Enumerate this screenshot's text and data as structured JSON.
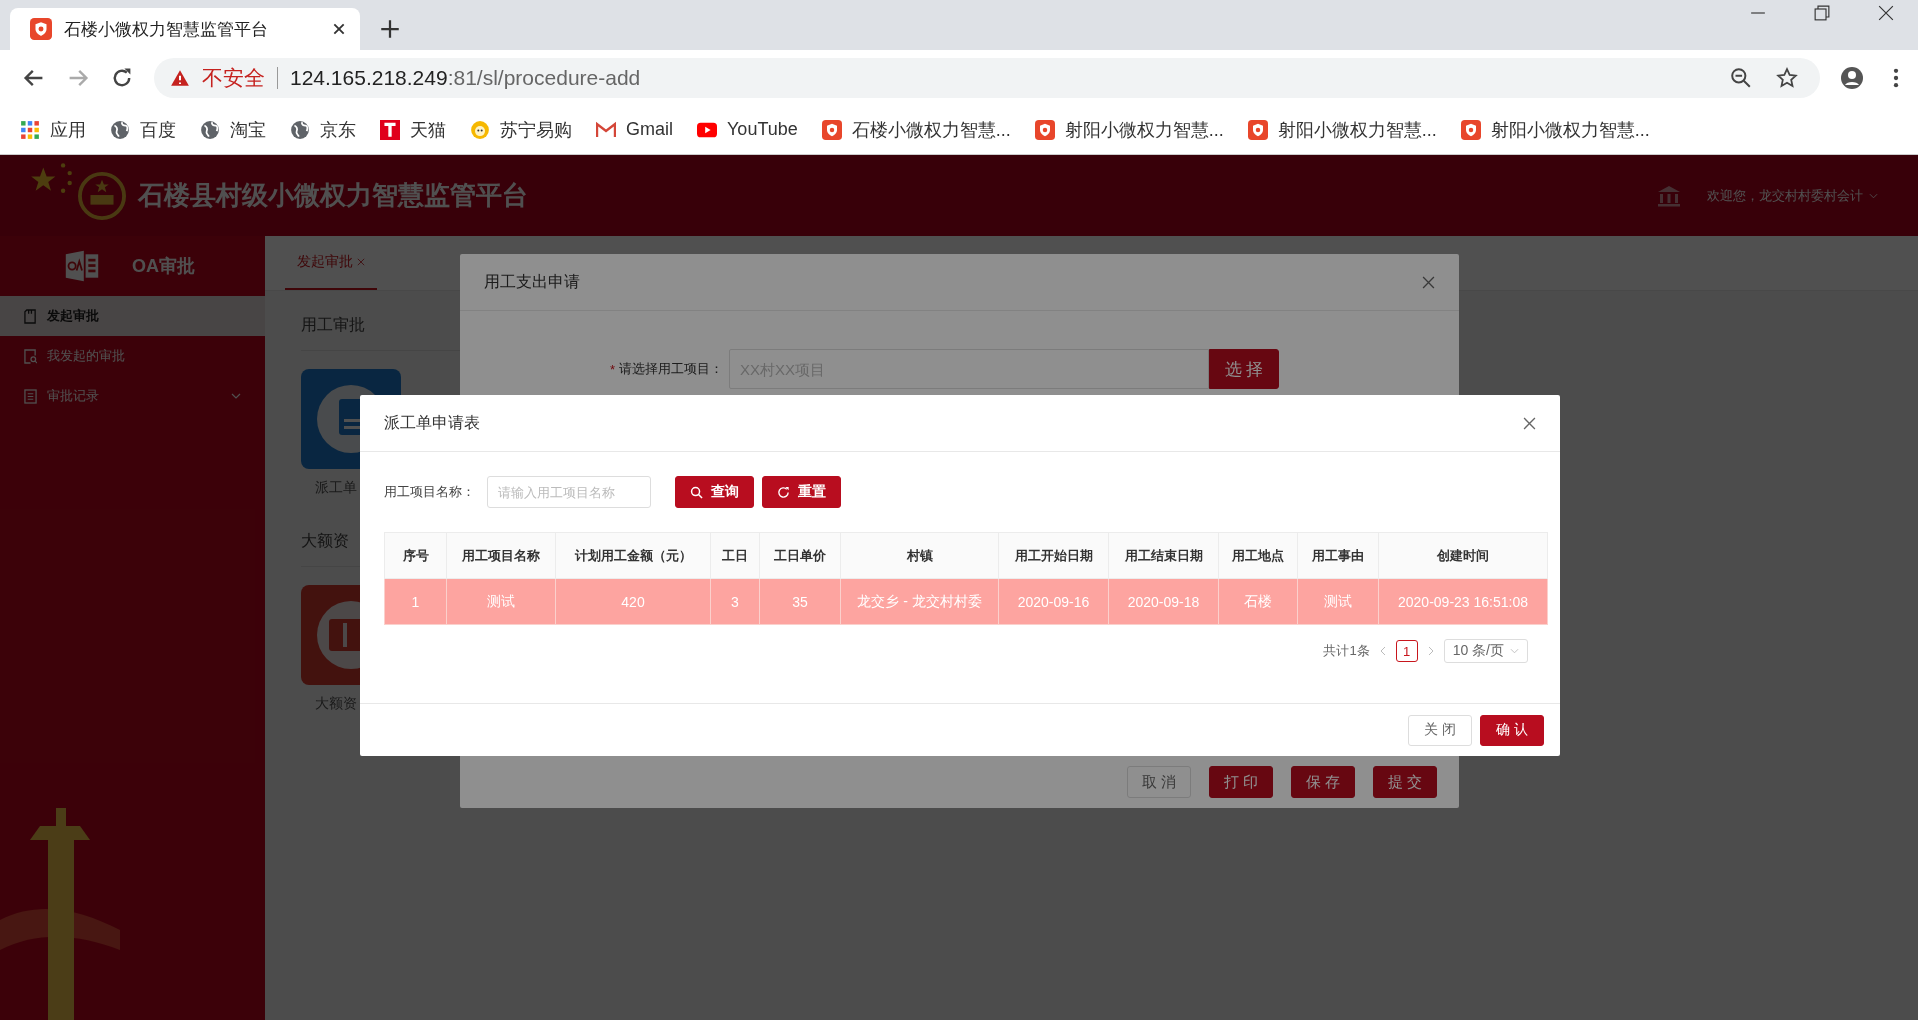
{
  "browser": {
    "tab_title": "石楼小微权力智慧监管平台",
    "security": "不安全",
    "url_host": "124.165.218.249",
    "url_rest": ":81/sl/procedure-add",
    "bookmarks": [
      {
        "label": "应用",
        "kind": "apps"
      },
      {
        "label": "百度",
        "kind": "globe"
      },
      {
        "label": "淘宝",
        "kind": "globe"
      },
      {
        "label": "京东",
        "kind": "globe"
      },
      {
        "label": "天猫",
        "kind": "tmall"
      },
      {
        "label": "苏宁易购",
        "kind": "suning"
      },
      {
        "label": "Gmail",
        "kind": "gmail"
      },
      {
        "label": "YouTube",
        "kind": "youtube"
      },
      {
        "label": "石楼小微权力智慧...",
        "kind": "shield"
      },
      {
        "label": "射阳小微权力智慧...",
        "kind": "shield"
      },
      {
        "label": "射阳小微权力智慧...",
        "kind": "shield"
      },
      {
        "label": "射阳小微权力智慧...",
        "kind": "shield"
      }
    ]
  },
  "header": {
    "title": "石楼县村级小微权力智慧监管平台",
    "user": "欢迎您，龙交村村委村会计"
  },
  "sidebar": {
    "title": "OA审批",
    "items": [
      {
        "label": "发起审批",
        "selected": true,
        "kind": "doc"
      },
      {
        "label": "我发起的审批",
        "selected": false,
        "kind": "search"
      },
      {
        "label": "审批记录",
        "selected": false,
        "kind": "list",
        "expanded": false
      }
    ]
  },
  "content": {
    "tabs": [
      {
        "label": "发起审批",
        "selected": true
      }
    ],
    "sections": [
      {
        "title": "用工审批",
        "cards": [
          {
            "label": "派工单",
            "kind": "dispatch"
          }
        ]
      },
      {
        "title": "大额资",
        "cards": [
          {
            "label": "大额资",
            "kind": "funds"
          }
        ]
      }
    ]
  },
  "form_dialog": {
    "title": "用工支出申请",
    "field": {
      "required_mark": "*",
      "label": "请选择用工项目：",
      "placeholder": "XX村XX项目",
      "button": "选 择"
    },
    "buttons": [
      {
        "label": "取 消",
        "kind": "default"
      },
      {
        "label": "打 印",
        "kind": "primary"
      },
      {
        "label": "保 存",
        "kind": "primary"
      },
      {
        "label": "提 交",
        "kind": "primary"
      }
    ]
  },
  "picker_dialog": {
    "title": "派工单申请表",
    "search": {
      "label": "用工项目名称：",
      "placeholder": "请输入用工项目名称",
      "query_button": "查询",
      "reset_button": "重置"
    },
    "table": {
      "columns": [
        "序号",
        "用工项目名称",
        "计划用工金额（元）",
        "工日",
        "工日单价",
        "村镇",
        "用工开始日期",
        "用工结束日期",
        "用工地点",
        "用工事由",
        "创建时间"
      ],
      "rows": [
        {
          "selected": true,
          "cells": [
            "1",
            "测试",
            "420",
            "3",
            "35",
            "龙交乡 - 龙交村村委",
            "2020-09-16",
            "2020-09-18",
            "石楼",
            "测试",
            "2020-09-23 16:51:08"
          ]
        }
      ]
    },
    "pagination": {
      "total": "共计1条",
      "pages": [
        {
          "label": "1",
          "selected": true
        }
      ],
      "page_size": "10 条/页"
    },
    "buttons": [
      {
        "label": "关 闭",
        "kind": "default"
      },
      {
        "label": "确 认",
        "kind": "primary"
      }
    ]
  }
}
